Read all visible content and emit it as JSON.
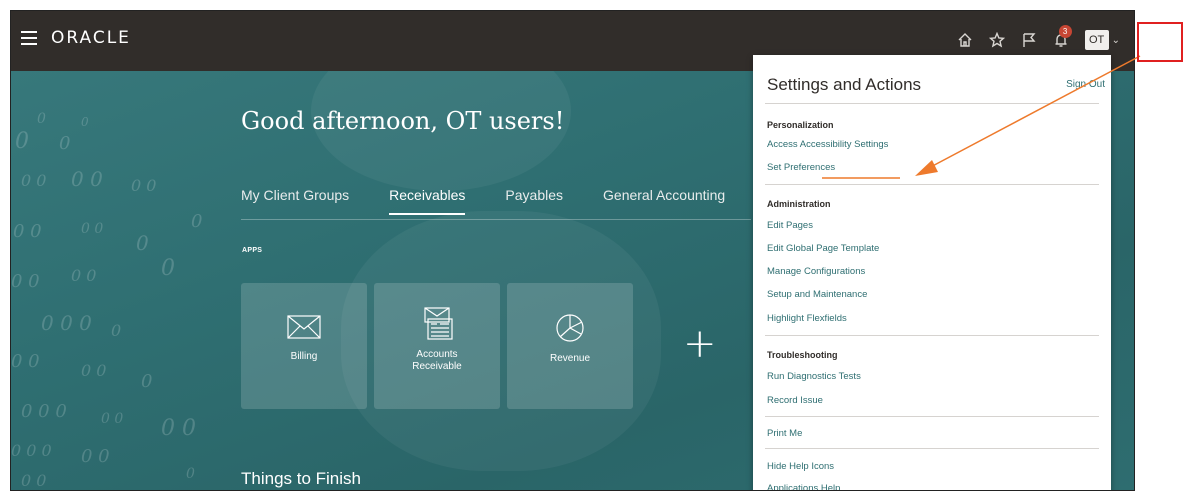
{
  "header": {
    "logo": "ORACLE",
    "notification_count": "3",
    "user_initials": "OT",
    "icons": [
      "home-icon",
      "favorites-star-icon",
      "flag-icon",
      "notifications-bell-icon"
    ]
  },
  "home": {
    "greeting": "Good afternoon, OT users!",
    "tabs": [
      {
        "label": "My Client Groups"
      },
      {
        "label": "Receivables"
      },
      {
        "label": "Payables"
      },
      {
        "label": "General Accounting"
      }
    ],
    "active_tab": "Receivables",
    "apps_label": "APPS",
    "apps": [
      {
        "label": "Billing",
        "icon": "envelope-icon"
      },
      {
        "label": "Accounts Receivable",
        "icon": "invoice-icon"
      },
      {
        "label": "Revenue",
        "icon": "pie-chart-icon"
      }
    ],
    "add_icon": "plus-icon",
    "things_to_finish": "Things to Finish"
  },
  "settings_panel": {
    "title": "Settings and Actions",
    "sign_out": "Sign Out",
    "sections": [
      {
        "heading": "Personalization",
        "items": [
          "Access Accessibility Settings",
          "Set Preferences"
        ]
      },
      {
        "heading": "Administration",
        "items": [
          "Edit Pages",
          "Edit Global Page Template",
          "Manage Configurations",
          "Setup and Maintenance",
          "Highlight Flexfields"
        ]
      },
      {
        "heading": "Troubleshooting",
        "items": [
          "Run Diagnostics Tests",
          "Record Issue"
        ]
      },
      {
        "heading": "",
        "items": [
          "Print Me"
        ]
      },
      {
        "heading": "",
        "items": [
          "Hide Help Icons",
          "Applications Help"
        ]
      }
    ]
  },
  "colors": {
    "header_bg": "#312d2a",
    "hero_teal": "#2d6b6e",
    "link": "#2f6f72",
    "badge": "#c74634",
    "annotation_arrow": "#ee7a2c",
    "annotation_box": "#e02020"
  }
}
